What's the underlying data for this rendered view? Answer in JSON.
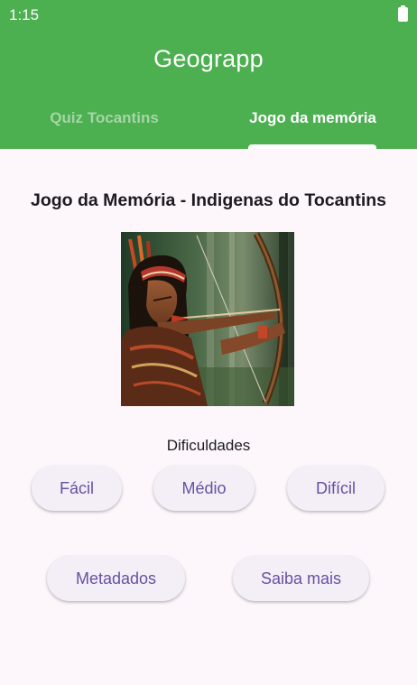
{
  "status_bar": {
    "time": "1:15",
    "battery_icon": "battery-full-icon"
  },
  "app": {
    "title": "Geograpp"
  },
  "tabs": [
    {
      "label": "Quiz Tocantins",
      "selected": false
    },
    {
      "label": "Jogo da memória",
      "selected": true
    }
  ],
  "main": {
    "title": "Jogo da Memória - Indigenas do Tocantins",
    "difficulty_label": "Dificuldades",
    "difficulty_buttons": [
      "Fácil",
      "Médio",
      "Difícil"
    ],
    "bottom_buttons": [
      "Metadados",
      "Saiba mais"
    ]
  },
  "colors": {
    "app_bar": "#4caf50",
    "button_text": "#6750a4",
    "button_bg": "#f4eff7",
    "background": "#fdf7fc"
  }
}
